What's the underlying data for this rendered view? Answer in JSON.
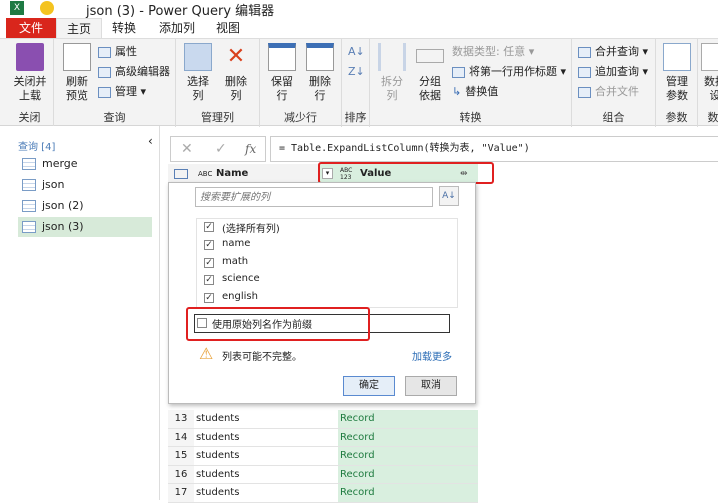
{
  "window": {
    "title": "json (3) - Power Query 编辑器"
  },
  "tabs": [
    "文件",
    "主页",
    "转换",
    "添加列",
    "视图"
  ],
  "ribbon": {
    "close": {
      "btn": "关闭并\n上载",
      "label": "关闭"
    },
    "query": {
      "refresh": "刷新\n预览",
      "props": "属性",
      "advanced": "高级编辑器",
      "manage": "管理",
      "label": "查询"
    },
    "cols": {
      "choose": "选择\n列",
      "remove": "删除\n列",
      "label": "管理列"
    },
    "rows": {
      "keep": "保留\n行",
      "remove": "删除\n行",
      "label": "减少行"
    },
    "sort": {
      "label": "排序"
    },
    "transform": {
      "split": "拆分\n列",
      "group": "分组\n依据",
      "dtype": "数据类型: 任意",
      "firstrow": "将第一行用作标题",
      "replace": "替换值",
      "label": "转换"
    },
    "combine": {
      "merge": "合并查询",
      "append": "追加查询",
      "files": "合并文件",
      "label": "组合"
    },
    "params": {
      "manage": "管理\n参数",
      "label": "参数"
    },
    "data": {
      "btn": "数据\n设",
      "label": "数"
    }
  },
  "queries": {
    "header": "查询 [4]",
    "items": [
      "merge",
      "json",
      "json (2)",
      "json (3)"
    ]
  },
  "formula": "= Table.ExpandListColumn(转换为表, \"Value\")",
  "columns": {
    "name": "Name",
    "value": "Value",
    "name_type": "ABC",
    "value_type": "ABC 123"
  },
  "popup": {
    "search_placeholder": "搜索要扩展的列",
    "items": [
      "(选择所有列)",
      "name",
      "math",
      "science",
      "english"
    ],
    "prefix": "使用原始列名作为前缀",
    "warning": "列表可能不完整。",
    "load_more": "加载更多",
    "ok": "确定",
    "cancel": "取消"
  },
  "rows": [
    {
      "n": "13",
      "name": "students",
      "value": "Record"
    },
    {
      "n": "14",
      "name": "students",
      "value": "Record"
    },
    {
      "n": "15",
      "name": "students",
      "value": "Record"
    },
    {
      "n": "16",
      "name": "students",
      "value": "Record"
    },
    {
      "n": "17",
      "name": "students",
      "value": "Record"
    }
  ]
}
